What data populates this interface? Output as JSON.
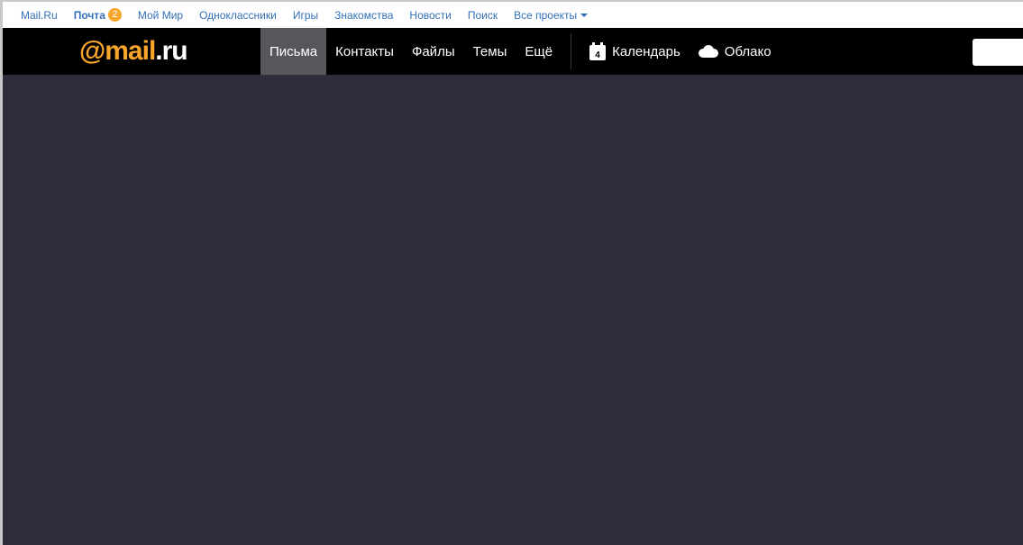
{
  "topbar": {
    "links": [
      "Mail.Ru",
      "Почта",
      "Мой Мир",
      "Одноклассники",
      "Игры",
      "Знакомства",
      "Новости",
      "Поиск",
      "Все проекты"
    ],
    "mail_badge": "2"
  },
  "logo": {
    "at": "@",
    "name": "mail",
    ".ru": ".ru"
  },
  "nav": {
    "items": [
      "Письма",
      "Контакты",
      "Файлы",
      "Темы",
      "Ещё"
    ],
    "calendar": "Календарь",
    "calendar_day": "4",
    "cloud": "Облако"
  },
  "colors": {
    "accent": "#f8a52c",
    "link": "#336fb7",
    "bg": "#2e2d3a"
  }
}
